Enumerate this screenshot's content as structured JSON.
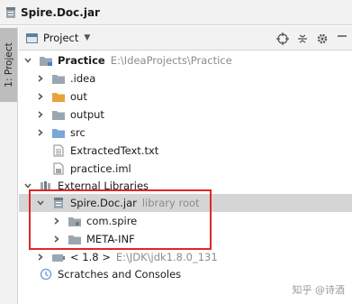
{
  "breadcrumb": {
    "title": "Spire.Doc.jar"
  },
  "side_tab": {
    "label": "1: Project"
  },
  "toolbar": {
    "view_label": "Project",
    "icons": [
      "locate-icon",
      "collapse-all-icon",
      "settings-icon",
      "hide-icon"
    ]
  },
  "tree": {
    "root": {
      "name": "Practice",
      "path": "E:\\IdeaProjects\\Practice"
    },
    "items": [
      {
        "label": ".idea"
      },
      {
        "label": "out"
      },
      {
        "label": "output"
      },
      {
        "label": "src"
      },
      {
        "label": "ExtractedText.txt"
      },
      {
        "label": "practice.iml"
      }
    ],
    "external_libraries": "External Libraries",
    "library": {
      "name": "Spire.Doc.jar",
      "hint": "library root"
    },
    "library_children": [
      {
        "label": "com.spire"
      },
      {
        "label": "META-INF"
      }
    ],
    "jdk": {
      "label": "< 1.8 >",
      "path": "E:\\JDK\\jdk1.8.0_131"
    },
    "scratches": "Scratches and Consoles"
  },
  "watermark": "知乎 @诗酒",
  "colors": {
    "highlight": "#e0262a",
    "folder": "#9aa7b0",
    "out_folder": "#e8a33d",
    "src_folder": "#7aa6d8"
  }
}
